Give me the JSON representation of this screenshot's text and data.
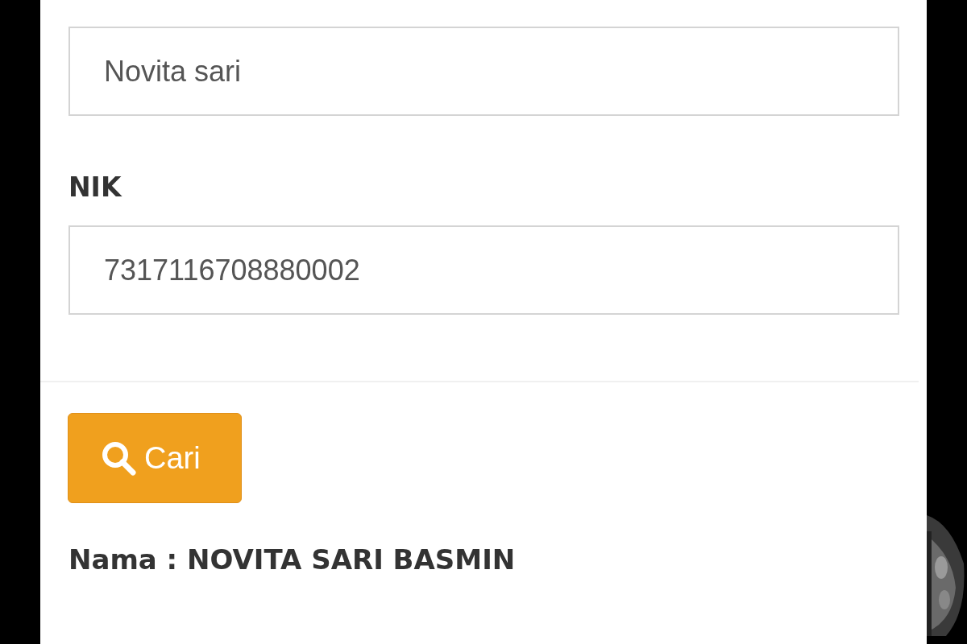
{
  "form": {
    "fields": [
      {
        "value": "Novita sari"
      },
      {
        "label": "NIK",
        "value": "7317116708880002"
      }
    ],
    "search_button": {
      "label": "Cari"
    },
    "result": "Nama : NOVITA SARI BASMIN"
  }
}
